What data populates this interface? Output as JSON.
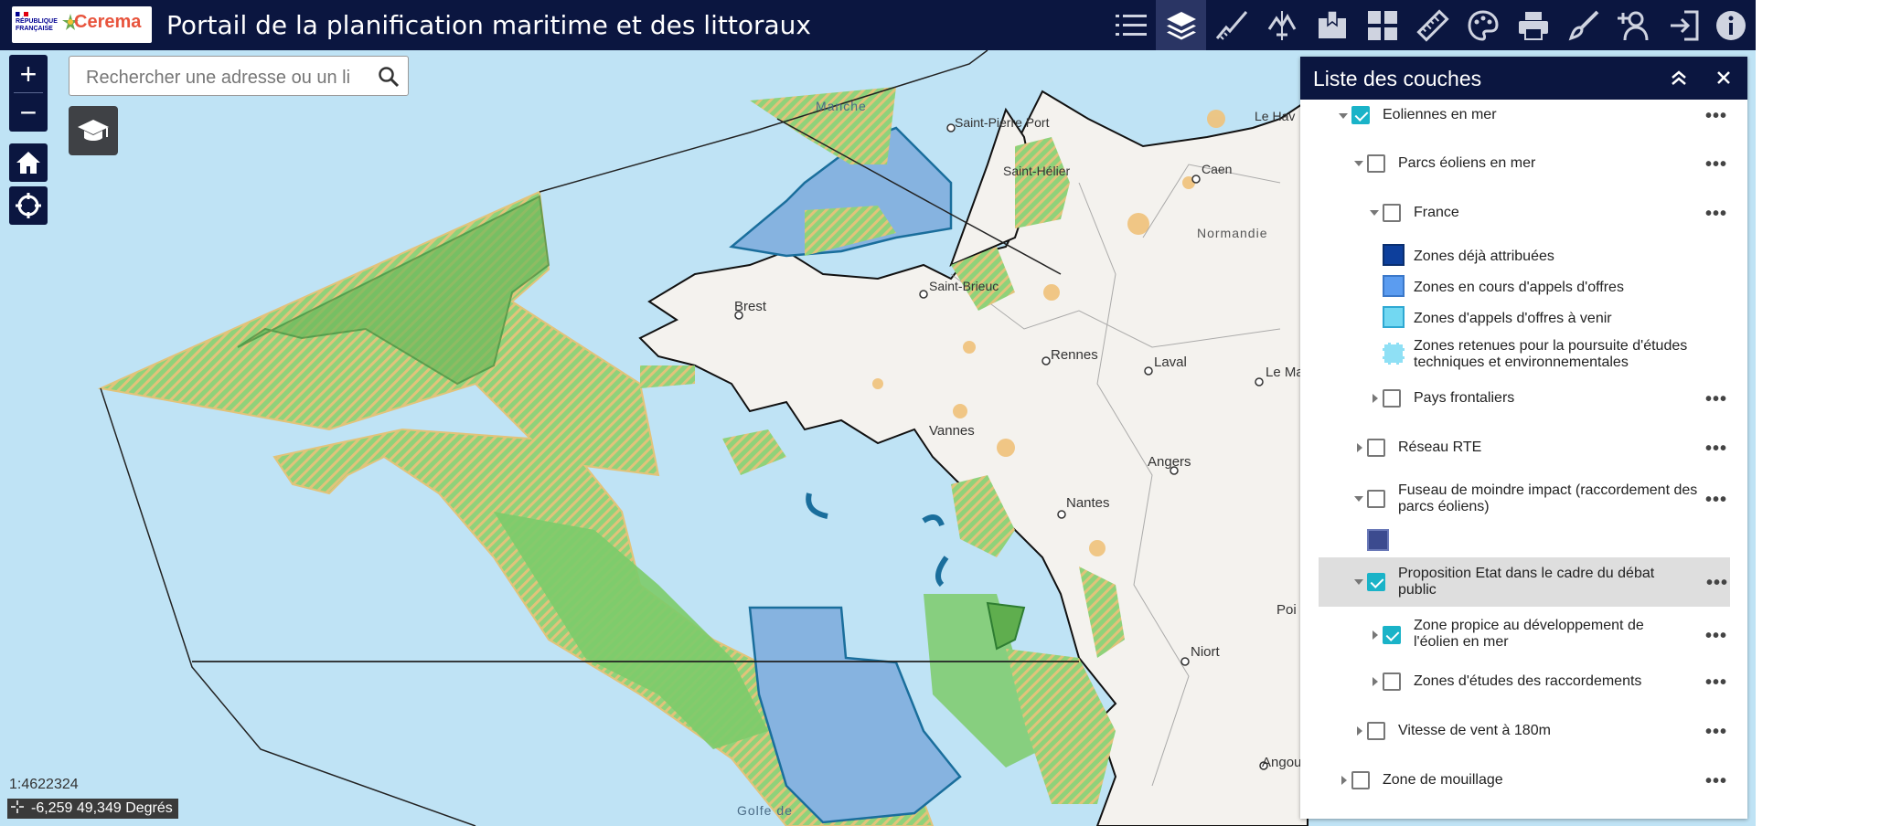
{
  "header": {
    "logo_rf_text": "RÉPUBLIQUE FRANÇAISE",
    "logo_brand": "Cerema",
    "title": "Portail de la planification maritime et des littoraux"
  },
  "toolbar": {
    "tools": [
      "list-icon",
      "layers-icon",
      "measure-profile-icon",
      "elevation-icon",
      "map-bookmark-icon",
      "apps-grid-icon",
      "ruler-icon",
      "draw-palette-icon",
      "print-icon",
      "edit-brush-icon",
      "add-user-icon",
      "login-icon",
      "info-icon"
    ],
    "active": "layers-icon"
  },
  "search": {
    "placeholder": "Rechercher une adresse ou un lie"
  },
  "map": {
    "scale": "1:4622324",
    "coords": "-6,259 49,349 Degrés",
    "labels": [
      {
        "id": "manche",
        "text": "Manche"
      },
      {
        "id": "saint-pierre-port",
        "text": "Saint-Pierre Port"
      },
      {
        "id": "saint-helier",
        "text": "Saint-Hélier"
      },
      {
        "id": "le-havre",
        "text": "Le Hav"
      },
      {
        "id": "caen",
        "text": "Caen"
      },
      {
        "id": "normandie",
        "text": "Normandie"
      },
      {
        "id": "brest",
        "text": "Brest"
      },
      {
        "id": "saint-brieuc",
        "text": "Saint-Brieuc"
      },
      {
        "id": "rennes",
        "text": "Rennes"
      },
      {
        "id": "laval",
        "text": "Laval"
      },
      {
        "id": "le-mans",
        "text": "Le Ma"
      },
      {
        "id": "vannes",
        "text": "Vannes"
      },
      {
        "id": "angers",
        "text": "Angers"
      },
      {
        "id": "nantes",
        "text": "Nantes"
      },
      {
        "id": "poitiers",
        "text": "Poi"
      },
      {
        "id": "niort",
        "text": "Niort"
      },
      {
        "id": "angouleme",
        "text": "Angoul"
      },
      {
        "id": "golfe",
        "text": "Golfe de"
      }
    ],
    "colors": {
      "sea": "#bfe3f5",
      "land": "#f4f2ee",
      "zone_green": "#7ccb6a",
      "zone_blue": "#6fa8dc",
      "hatch": "#e8b86e",
      "urban": "#f0c27a"
    }
  },
  "panel": {
    "title": "Liste des couches",
    "rows": [
      {
        "label": "Eoliennes en mer",
        "checked": true,
        "caret": "down",
        "level": 0
      },
      {
        "label": "Parcs éoliens en mer",
        "checked": false,
        "caret": "down",
        "level": 1
      },
      {
        "label": "France",
        "checked": false,
        "caret": "down",
        "level": 2
      },
      {
        "label": "Pays frontaliers",
        "checked": false,
        "caret": "right",
        "level": 2
      },
      {
        "label": "Réseau RTE",
        "checked": false,
        "caret": "right",
        "level": 1
      },
      {
        "label": "Fuseau de moindre impact (raccordement des parcs éoliens)",
        "checked": false,
        "caret": "down",
        "level": 1
      },
      {
        "label": "Proposition Etat dans le cadre du débat public",
        "checked": true,
        "caret": "down",
        "level": 1,
        "selected": true
      },
      {
        "label": "Zone propice au développement de l'éolien en mer",
        "checked": true,
        "caret": "right",
        "level": 2
      },
      {
        "label": "Zones d'études des raccordements",
        "checked": false,
        "caret": "right",
        "level": 2
      },
      {
        "label": "Vitesse de vent à 180m",
        "checked": false,
        "caret": "right",
        "level": 1
      },
      {
        "label": "Zone de mouillage",
        "checked": false,
        "caret": "right",
        "level": 0
      }
    ],
    "legend": [
      {
        "label": "Zones déjà attribuées",
        "color": "#0d3f9c"
      },
      {
        "label": "Zones en cours d'appels d'offres",
        "color": "#5b9cf0"
      },
      {
        "label": "Zones d'appels d'offres à venir",
        "color": "#72d8f2"
      },
      {
        "label": "Zones retenues pour la poursuite d'études techniques et environnementales",
        "color": "#8fe0f5"
      }
    ],
    "fuseau_color": "#3c4b8f"
  }
}
